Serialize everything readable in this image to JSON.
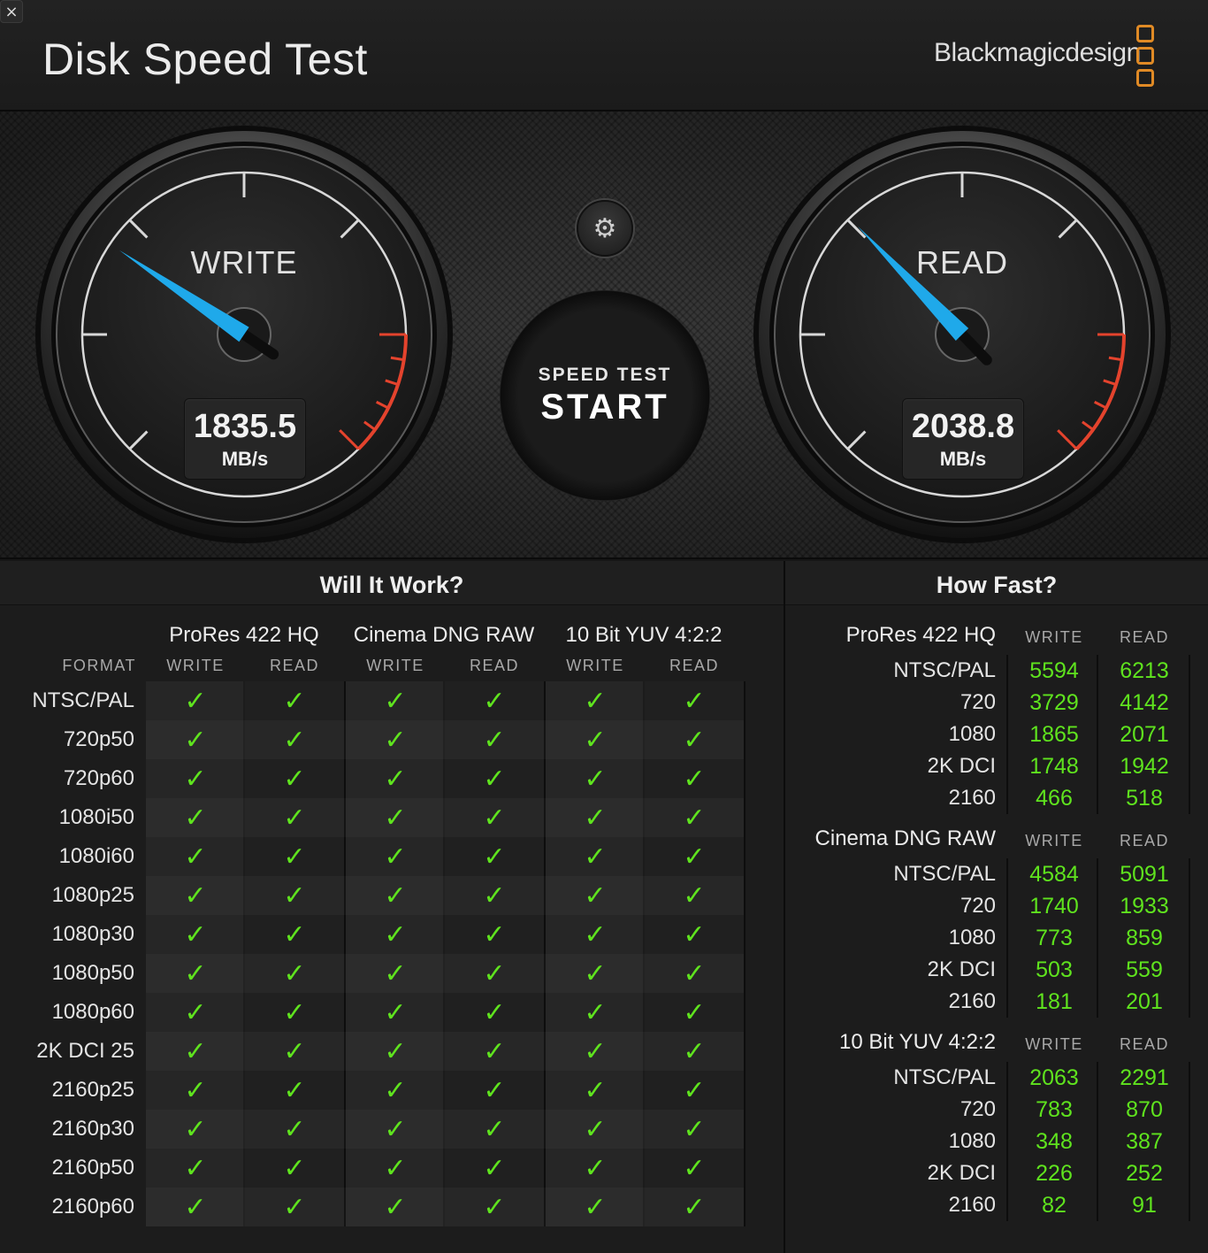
{
  "window": {
    "close_glyph": "×",
    "title": "Disk Speed Test",
    "brand": "Blackmagicdesign"
  },
  "gauges": {
    "write": {
      "label": "WRITE",
      "value": "1835.5",
      "unit": "MB/s"
    },
    "read": {
      "label": "READ",
      "value": "2038.8",
      "unit": "MB/s"
    }
  },
  "controls": {
    "settings_icon": "gear-icon",
    "settings_glyph": "⚙",
    "start_small": "SPEED TEST",
    "start_big": "START"
  },
  "will_it_work": {
    "title": "Will It Work?",
    "format_header": "FORMAT",
    "groups": [
      "ProRes 422 HQ",
      "Cinema DNG RAW",
      "10 Bit YUV 4:2:2"
    ],
    "col_write": "WRITE",
    "col_read": "READ",
    "check_glyph": "✓",
    "rows": [
      "NTSC/PAL",
      "720p50",
      "720p60",
      "1080i50",
      "1080i60",
      "1080p25",
      "1080p30",
      "1080p50",
      "1080p60",
      "2K DCI 25",
      "2160p25",
      "2160p30",
      "2160p50",
      "2160p60"
    ],
    "result": "all-pass",
    "check_color": "#5fe31e"
  },
  "how_fast": {
    "title": "How Fast?",
    "col_write": "WRITE",
    "col_read": "READ",
    "value_color": "#5fe31e",
    "groups": [
      {
        "name": "ProRes 422 HQ",
        "rows": [
          {
            "label": "NTSC/PAL",
            "write": "5594",
            "read": "6213"
          },
          {
            "label": "720",
            "write": "3729",
            "read": "4142"
          },
          {
            "label": "1080",
            "write": "1865",
            "read": "2071"
          },
          {
            "label": "2K DCI",
            "write": "1748",
            "read": "1942"
          },
          {
            "label": "2160",
            "write": "466",
            "read": "518"
          }
        ]
      },
      {
        "name": "Cinema DNG RAW",
        "rows": [
          {
            "label": "NTSC/PAL",
            "write": "4584",
            "read": "5091"
          },
          {
            "label": "720",
            "write": "1740",
            "read": "1933"
          },
          {
            "label": "1080",
            "write": "773",
            "read": "859"
          },
          {
            "label": "2K DCI",
            "write": "503",
            "read": "559"
          },
          {
            "label": "2160",
            "write": "181",
            "read": "201"
          }
        ]
      },
      {
        "name": "10 Bit YUV 4:2:2",
        "rows": [
          {
            "label": "NTSC/PAL",
            "write": "2063",
            "read": "2291"
          },
          {
            "label": "720",
            "write": "783",
            "read": "870"
          },
          {
            "label": "1080",
            "write": "348",
            "read": "387"
          },
          {
            "label": "2K DCI",
            "write": "226",
            "read": "252"
          },
          {
            "label": "2160",
            "write": "82",
            "read": "91"
          }
        ]
      }
    ]
  },
  "colors": {
    "needle": "#1fa9ea",
    "redzone": "#e4432d",
    "brand_logo": "#e08a25",
    "pass_green": "#5fe31e"
  }
}
